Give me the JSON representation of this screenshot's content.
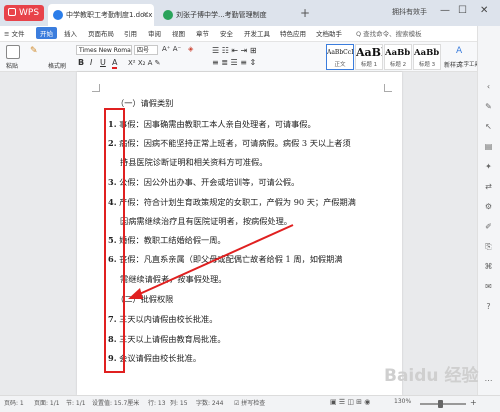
{
  "titlebar": {
    "app_label": "WPS",
    "tabs": [
      {
        "label": "中学教职工考勤制度1.docx"
      },
      {
        "label": "刘张子博中学...考勤管理制度"
      }
    ],
    "plus": "+",
    "user": "拥抖有效手",
    "min": "—",
    "max": "☐",
    "close": "✕"
  },
  "menu": {
    "file": "≡ 文件",
    "items": [
      "开始",
      "插入",
      "页面布局",
      "引用",
      "审阅",
      "视图",
      "章节",
      "安全",
      "开发工具",
      "特色应用",
      "文档助手"
    ],
    "search": "Q 查找命令、搜索模板"
  },
  "ribbon": {
    "paste": "粘贴",
    "format_painter": "格式刷",
    "font_name": "Times New Roma",
    "font_size": "四号",
    "bold": "B",
    "italic": "I",
    "underline": "U",
    "font_color": "A",
    "styles": [
      {
        "preview": "AaBbCcDt",
        "label": "正文"
      },
      {
        "preview": "AaBl",
        "label": "标题 1"
      },
      {
        "preview": "AaBb(",
        "label": "标题 2"
      },
      {
        "preview": "AaBb(",
        "label": "标题 3"
      }
    ],
    "new_style": "新样式",
    "text_tools": "文字工具"
  },
  "document": {
    "lines": [
      {
        "text": "（一）请假类别"
      },
      {
        "num": "1.",
        "text": "事假：因事确需由教职工本人亲自处理者，可请事假。"
      },
      {
        "num": "2.",
        "text": "病假：因病不能坚持正常上班者，可请病假。病假 3 天以上者须"
      },
      {
        "text": "持县医院诊断证明和相关资料方可准假。"
      },
      {
        "num": "3.",
        "text": "公假：因公外出办事、开会或培训等，可请公假。"
      },
      {
        "num": "4.",
        "text": "产假：符合计划生育政策规定的女职工，产假为 90 天；产假期满"
      },
      {
        "text": "因病需继续治疗且有医院证明者，按病假处理。"
      },
      {
        "num": "5.",
        "text": "婚假：教职工结婚给假一周。"
      },
      {
        "num": "6.",
        "text": "丧假：凡直系亲属（即父母或配偶亡故者给假 1 周，如假期满"
      },
      {
        "text": "需继续请假者，按事假处理。"
      },
      {
        "text": "（二）批假权限"
      },
      {
        "num": "7.",
        "text": "三天以内请假由校长批准。"
      },
      {
        "num": "8.",
        "text": "三天以上请假由教育局批准。"
      },
      {
        "num": "9.",
        "text": "会议请假由校长批准。"
      }
    ]
  },
  "statusbar": {
    "page": "页码: 1",
    "pages": "页面: 1/1",
    "section": "节: 1/1",
    "position": "设置值: 15.7厘米",
    "row": "行: 13",
    "col": "列: 15",
    "words": "字数: 244",
    "spell": "☑ 拼写检查",
    "zoom": "130%"
  },
  "watermark": "Baidu 经验",
  "colors": {
    "accent": "#3b7ddd",
    "wps_red": "#e8434a",
    "annotation_red": "#e02020"
  }
}
